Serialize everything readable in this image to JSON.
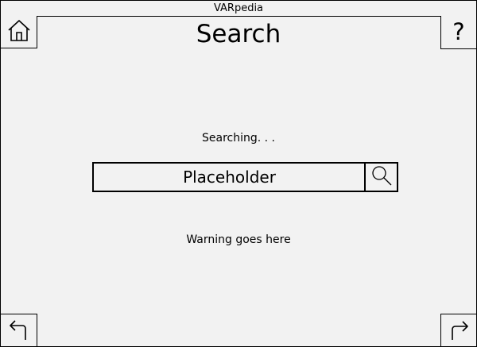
{
  "app": {
    "title": "VARpedia"
  },
  "header": {
    "page_title": "Search",
    "help_label": "?"
  },
  "main": {
    "status_text": "Searching. . .",
    "search": {
      "placeholder": "Placeholder",
      "value": ""
    },
    "warning_text": "Warning goes here"
  },
  "icons": {
    "home": "home-icon",
    "search": "search-icon",
    "back": "back-arrow-icon",
    "forward": "forward-arrow-icon"
  }
}
